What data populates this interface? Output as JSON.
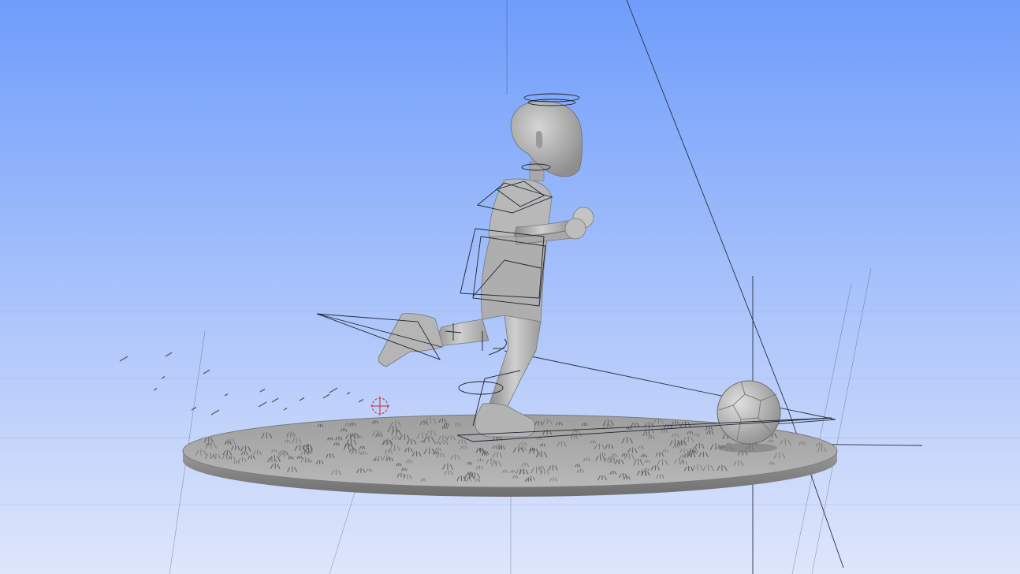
{
  "viewport": {
    "background_top": "#6f9dfb",
    "background_bottom": "#dfe6fb"
  },
  "scene": {
    "objects": [
      "ground-disc",
      "grass-patches",
      "grass-debris",
      "character",
      "soccer-ball",
      "ik-handles",
      "camera-guides",
      "grid-lines"
    ]
  },
  "colors": {
    "mesh_light": "#c9c9c9",
    "mesh_mid": "#a9a9a9",
    "mesh_dark": "#6f6f6f",
    "wire": "#1e2430",
    "grid": "#9fb2da",
    "marker": "#c03030"
  }
}
